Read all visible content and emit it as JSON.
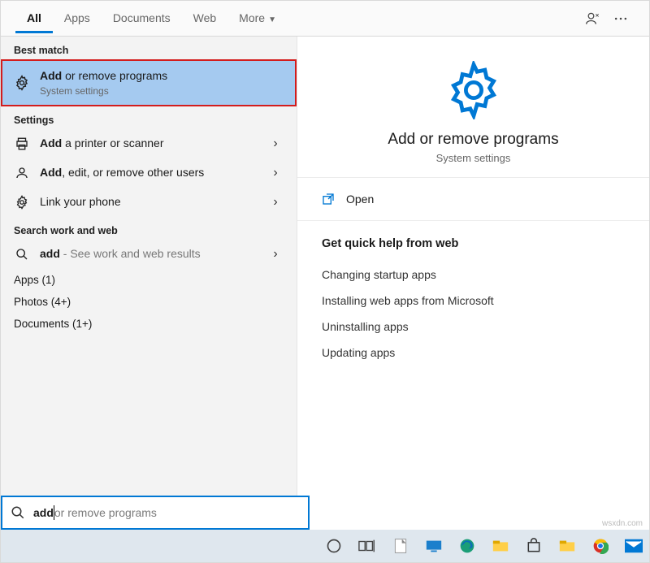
{
  "tabs": {
    "all": "All",
    "apps": "Apps",
    "documents": "Documents",
    "web": "Web",
    "more": "More"
  },
  "left": {
    "best_match_header": "Best match",
    "best_match": {
      "title_bold": "Add",
      "title_rest": " or remove programs",
      "subtitle": "System settings"
    },
    "settings_header": "Settings",
    "settings": [
      {
        "bold": "Add",
        "rest": " a printer or scanner"
      },
      {
        "bold": "Add",
        "rest": ", edit, or remove other users"
      },
      {
        "bold": "",
        "rest": "Link your phone"
      }
    ],
    "search_web_header": "Search work and web",
    "search_web": {
      "bold": "add",
      "suffix": " - See work and web results"
    },
    "apps_header": "Apps (1)",
    "photos_header": "Photos (4+)",
    "documents_header": "Documents (1+)"
  },
  "right": {
    "title": "Add or remove programs",
    "subtitle": "System settings",
    "open_label": "Open",
    "quick_header": "Get quick help from web",
    "quick_links": [
      "Changing startup apps",
      "Installing web apps from Microsoft",
      "Uninstalling apps",
      "Updating apps"
    ]
  },
  "search": {
    "typed_bold": "add",
    "ghost": " or remove programs"
  },
  "watermark": "wsxdn.com"
}
